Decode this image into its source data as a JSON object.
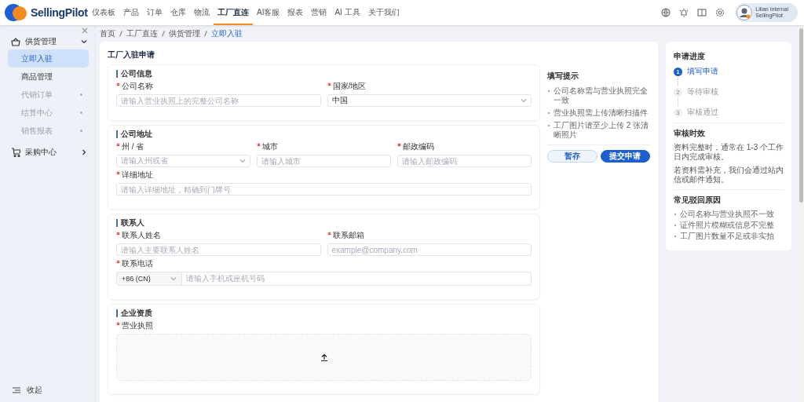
{
  "brand": {
    "name": "SellingPilot"
  },
  "nav": [
    {
      "label": "仪表板",
      "selected": false
    },
    {
      "label": "产品",
      "selected": false
    },
    {
      "label": "订单",
      "selected": false
    },
    {
      "label": "仓库",
      "selected": false
    },
    {
      "label": "物流",
      "selected": false
    },
    {
      "label": "工厂直连",
      "selected": true
    },
    {
      "label": "AI客服",
      "selected": false
    },
    {
      "label": "报表",
      "selected": false
    },
    {
      "label": "营销",
      "selected": false
    },
    {
      "label": "AI 工具",
      "selected": false
    },
    {
      "label": "关于我们",
      "selected": false
    }
  ],
  "user": {
    "name": "Lilian Internal",
    "org": "SellingPilot"
  },
  "sidebar": {
    "groups": [
      {
        "label": "供货管理",
        "expanded": true,
        "children": [
          {
            "label": "立即入驻",
            "selected": true,
            "disabled": false
          },
          {
            "label": "商品管理",
            "selected": false,
            "disabled": false
          },
          {
            "label": "代销订单",
            "selected": false,
            "disabled": true
          },
          {
            "label": "结算中心",
            "selected": false,
            "disabled": true
          },
          {
            "label": "销售报表",
            "selected": false,
            "disabled": true
          }
        ]
      },
      {
        "label": "采购中心",
        "expanded": false
      }
    ],
    "collapse": "收起"
  },
  "breadcrumb": [
    "首页",
    "工厂直连",
    "供货管理",
    "立即入驻"
  ],
  "form": {
    "title": "工厂入驻申请",
    "sections": [
      {
        "title": "公司信息",
        "rows": [
          [
            {
              "kind": "input",
              "label": "公司名称",
              "required": true,
              "placeholder": "请输入营业执照上的完整公司名称"
            },
            {
              "kind": "select",
              "label": "国家/地区",
              "required": true,
              "value": "中国"
            }
          ]
        ]
      },
      {
        "title": "公司地址",
        "rows": [
          [
            {
              "kind": "select",
              "label": "州 / 省",
              "required": true,
              "placeholder": "请输入州或省"
            },
            {
              "kind": "input",
              "label": "城市",
              "required": true,
              "placeholder": "请输入城市"
            },
            {
              "kind": "input",
              "label": "邮政编码",
              "required": true,
              "placeholder": "请输入邮政编码"
            }
          ],
          [
            {
              "kind": "input",
              "label": "详细地址",
              "required": true,
              "placeholder": "请输入详细地址，精确到门牌号"
            }
          ]
        ]
      },
      {
        "title": "联系人",
        "rows": [
          [
            {
              "kind": "input",
              "label": "联系人姓名",
              "required": true,
              "placeholder": "请输入主要联系人姓名"
            },
            {
              "kind": "input",
              "label": "联系邮箱",
              "required": true,
              "placeholder": "example@company.com"
            }
          ],
          [
            {
              "kind": "phone",
              "label": "联系电话",
              "required": true,
              "code": "+86 (CN)",
              "placeholder": "请输入手机或座机号码"
            }
          ]
        ]
      },
      {
        "title": "企业资质",
        "rows": [
          [
            {
              "kind": "upload",
              "label": "营业执照",
              "required": true
            }
          ]
        ]
      }
    ]
  },
  "tips": {
    "title": "填写提示",
    "items": [
      "公司名称需与营业执照完全一致",
      "营业执照需上传清晰扫描件",
      "工厂图片请至少上传 2 张清晰照片"
    ]
  },
  "buttons": [
    {
      "label": "暂存",
      "kind": "secondary"
    },
    {
      "label": "提交申请",
      "kind": "primary"
    }
  ],
  "progress": {
    "title": "申请进度",
    "steps": [
      {
        "number": "1",
        "label": "填写申请",
        "selected": true
      },
      {
        "number": "2",
        "label": "等待审核",
        "selected": false
      },
      {
        "number": "3",
        "label": "审核通过",
        "selected": false
      }
    ]
  },
  "review_time": {
    "title": "审核时效",
    "lines": [
      "资料完整时，通常在 1-3 个工作日内完成审核。",
      "若资料需补充，我们会通过站内信或邮件通知。"
    ]
  },
  "reject_reasons": {
    "title": "常见驳回原因",
    "items": [
      "公司名称与营业执照不一致",
      "证件照片模糊或信息不完整",
      "工厂图片数量不足或非实拍"
    ]
  }
}
